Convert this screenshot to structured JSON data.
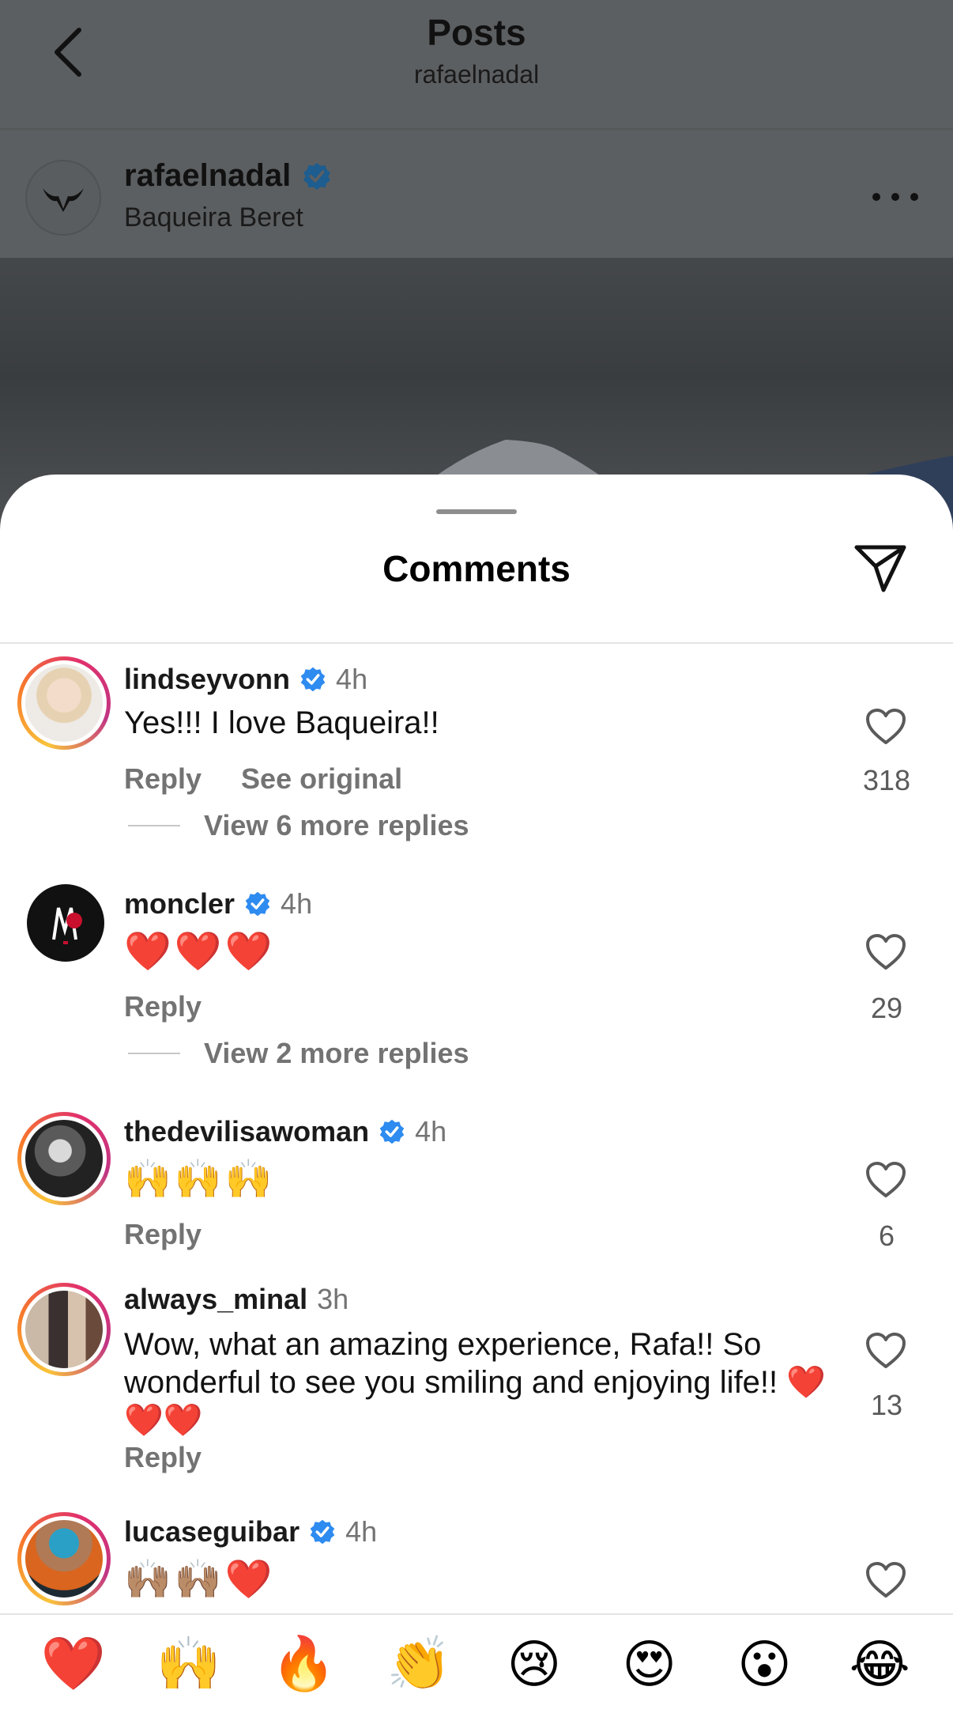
{
  "header": {
    "title": "Posts",
    "subtitle": "rafaelnadal"
  },
  "post": {
    "username": "rafaelnadal",
    "location": "Baqueira Beret"
  },
  "sheet": {
    "title": "Comments"
  },
  "comments": [
    {
      "username": "lindseyvonn",
      "time": "4h",
      "text": "Yes!!! I love Baqueira!!",
      "reply": "Reply",
      "see_original": "See original",
      "replies": "View 6 more replies",
      "likes": "318"
    },
    {
      "username": "moncler",
      "time": "4h",
      "text": "❤️❤️❤️",
      "reply": "Reply",
      "replies": "View 2 more replies",
      "likes": "29"
    },
    {
      "username": "thedevilisawoman",
      "time": "4h",
      "text": "🙌🙌🙌",
      "reply": "Reply",
      "likes": "6"
    },
    {
      "username": "always_minal",
      "time": "3h",
      "text": "Wow, what an amazing experience, Rafa!! So wonderful to see you smiling and enjoying life!! ❤️❤️❤️",
      "reply": "Reply",
      "likes": "13"
    },
    {
      "username": "lucaseguibar",
      "time": "4h",
      "text": "🙌🏽🙌🏽❤️"
    }
  ],
  "reactions": [
    "❤️",
    "🙌",
    "🔥",
    "👏",
    "😢",
    "😍",
    "😮",
    "😂"
  ]
}
